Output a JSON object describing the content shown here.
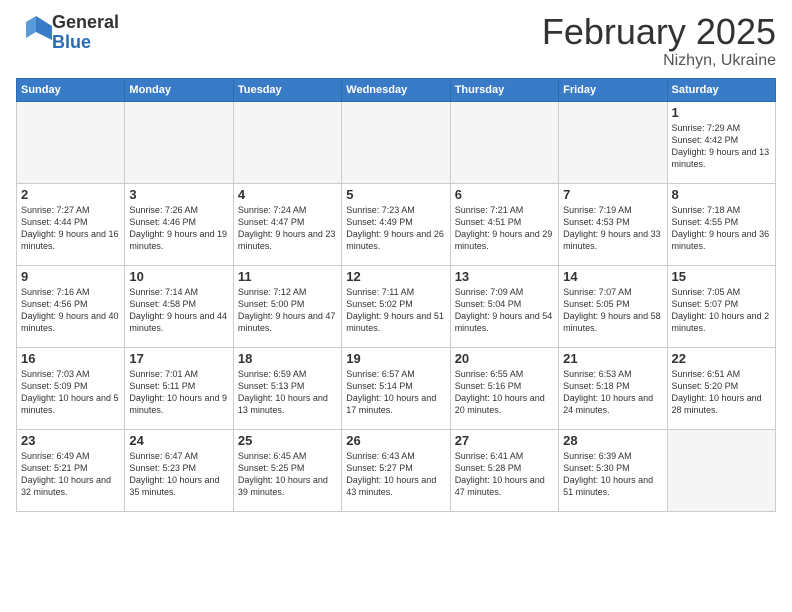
{
  "logo": {
    "general": "General",
    "blue": "Blue"
  },
  "header": {
    "month": "February 2025",
    "location": "Nizhyn, Ukraine"
  },
  "weekdays": [
    "Sunday",
    "Monday",
    "Tuesday",
    "Wednesday",
    "Thursday",
    "Friday",
    "Saturday"
  ],
  "weeks": [
    [
      {
        "day": null,
        "info": null
      },
      {
        "day": null,
        "info": null
      },
      {
        "day": null,
        "info": null
      },
      {
        "day": null,
        "info": null
      },
      {
        "day": null,
        "info": null
      },
      {
        "day": null,
        "info": null
      },
      {
        "day": "1",
        "info": "Sunrise: 7:29 AM\nSunset: 4:42 PM\nDaylight: 9 hours and 13 minutes."
      }
    ],
    [
      {
        "day": "2",
        "info": "Sunrise: 7:27 AM\nSunset: 4:44 PM\nDaylight: 9 hours and 16 minutes."
      },
      {
        "day": "3",
        "info": "Sunrise: 7:26 AM\nSunset: 4:46 PM\nDaylight: 9 hours and 19 minutes."
      },
      {
        "day": "4",
        "info": "Sunrise: 7:24 AM\nSunset: 4:47 PM\nDaylight: 9 hours and 23 minutes."
      },
      {
        "day": "5",
        "info": "Sunrise: 7:23 AM\nSunset: 4:49 PM\nDaylight: 9 hours and 26 minutes."
      },
      {
        "day": "6",
        "info": "Sunrise: 7:21 AM\nSunset: 4:51 PM\nDaylight: 9 hours and 29 minutes."
      },
      {
        "day": "7",
        "info": "Sunrise: 7:19 AM\nSunset: 4:53 PM\nDaylight: 9 hours and 33 minutes."
      },
      {
        "day": "8",
        "info": "Sunrise: 7:18 AM\nSunset: 4:55 PM\nDaylight: 9 hours and 36 minutes."
      }
    ],
    [
      {
        "day": "9",
        "info": "Sunrise: 7:16 AM\nSunset: 4:56 PM\nDaylight: 9 hours and 40 minutes."
      },
      {
        "day": "10",
        "info": "Sunrise: 7:14 AM\nSunset: 4:58 PM\nDaylight: 9 hours and 44 minutes."
      },
      {
        "day": "11",
        "info": "Sunrise: 7:12 AM\nSunset: 5:00 PM\nDaylight: 9 hours and 47 minutes."
      },
      {
        "day": "12",
        "info": "Sunrise: 7:11 AM\nSunset: 5:02 PM\nDaylight: 9 hours and 51 minutes."
      },
      {
        "day": "13",
        "info": "Sunrise: 7:09 AM\nSunset: 5:04 PM\nDaylight: 9 hours and 54 minutes."
      },
      {
        "day": "14",
        "info": "Sunrise: 7:07 AM\nSunset: 5:05 PM\nDaylight: 9 hours and 58 minutes."
      },
      {
        "day": "15",
        "info": "Sunrise: 7:05 AM\nSunset: 5:07 PM\nDaylight: 10 hours and 2 minutes."
      }
    ],
    [
      {
        "day": "16",
        "info": "Sunrise: 7:03 AM\nSunset: 5:09 PM\nDaylight: 10 hours and 5 minutes."
      },
      {
        "day": "17",
        "info": "Sunrise: 7:01 AM\nSunset: 5:11 PM\nDaylight: 10 hours and 9 minutes."
      },
      {
        "day": "18",
        "info": "Sunrise: 6:59 AM\nSunset: 5:13 PM\nDaylight: 10 hours and 13 minutes."
      },
      {
        "day": "19",
        "info": "Sunrise: 6:57 AM\nSunset: 5:14 PM\nDaylight: 10 hours and 17 minutes."
      },
      {
        "day": "20",
        "info": "Sunrise: 6:55 AM\nSunset: 5:16 PM\nDaylight: 10 hours and 20 minutes."
      },
      {
        "day": "21",
        "info": "Sunrise: 6:53 AM\nSunset: 5:18 PM\nDaylight: 10 hours and 24 minutes."
      },
      {
        "day": "22",
        "info": "Sunrise: 6:51 AM\nSunset: 5:20 PM\nDaylight: 10 hours and 28 minutes."
      }
    ],
    [
      {
        "day": "23",
        "info": "Sunrise: 6:49 AM\nSunset: 5:21 PM\nDaylight: 10 hours and 32 minutes."
      },
      {
        "day": "24",
        "info": "Sunrise: 6:47 AM\nSunset: 5:23 PM\nDaylight: 10 hours and 35 minutes."
      },
      {
        "day": "25",
        "info": "Sunrise: 6:45 AM\nSunset: 5:25 PM\nDaylight: 10 hours and 39 minutes."
      },
      {
        "day": "26",
        "info": "Sunrise: 6:43 AM\nSunset: 5:27 PM\nDaylight: 10 hours and 43 minutes."
      },
      {
        "day": "27",
        "info": "Sunrise: 6:41 AM\nSunset: 5:28 PM\nDaylight: 10 hours and 47 minutes."
      },
      {
        "day": "28",
        "info": "Sunrise: 6:39 AM\nSunset: 5:30 PM\nDaylight: 10 hours and 51 minutes."
      },
      {
        "day": null,
        "info": null
      }
    ]
  ]
}
